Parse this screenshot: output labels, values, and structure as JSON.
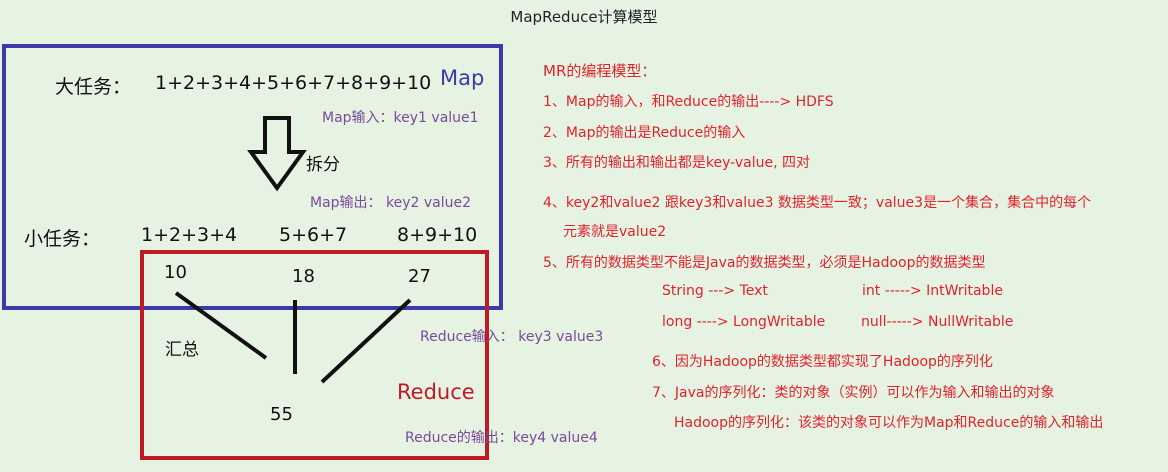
{
  "title": "MapReduce计算模型",
  "map_box": {
    "label": "Map",
    "big_task_label": "大任务：",
    "big_task_value": "1+2+3+4+5+6+7+8+9+10",
    "map_input": "Map输入：key1  value1",
    "split_label": "拆分",
    "map_output": "Map输出：  key2   value2",
    "small_task_label": "小任务：",
    "small_tasks": [
      "1+2+3+4",
      "5+6+7",
      "8+9+10"
    ]
  },
  "reduce_box": {
    "label": "Reduce",
    "partial_results": [
      "10",
      "18",
      "27"
    ],
    "summary_label": "汇总",
    "final_result": "55",
    "reduce_input": "Reduce输入：  key3    value3",
    "reduce_output": "Reduce的输出：key4    value4"
  },
  "notes": {
    "heading": "MR的编程模型：",
    "items": [
      "1、Map的输入，和Reduce的输出----> HDFS",
      "2、Map的输出是Reduce的输入",
      "3、所有的输出和输出都是key-value, 四对",
      "4、key2和value2  跟key3和value3 数据类型一致；value3是一个集合，集合中的每个",
      "元素就是value2",
      "5、所有的数据类型不能是Java的数据类型，必须是Hadoop的数据类型",
      "String  ---> Text",
      "int -----> IntWritable",
      "long    ----> LongWritable",
      "null-----> NullWritable",
      "6、因为Hadoop的数据类型都实现了Hadoop的序列化",
      "7、Java的序列化：类的对象（实例）可以作为输入和输出的对象",
      "Hadoop的序列化：该类的对象可以作为Map和Reduce的输入和输出"
    ]
  },
  "colors": {
    "background": "#e6f3e3",
    "map_border": "#3a3aa8",
    "reduce_border": "#c01a24",
    "note_text": "#e0222c",
    "secondary_text": "#7a4a9a"
  }
}
